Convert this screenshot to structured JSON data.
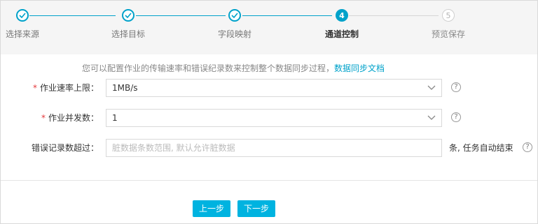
{
  "steps": [
    {
      "label": "选择来源",
      "status": "done"
    },
    {
      "label": "选择目标",
      "status": "done"
    },
    {
      "label": "字段映射",
      "status": "done"
    },
    {
      "label": "通道控制",
      "status": "active",
      "number": "4"
    },
    {
      "label": "预览保存",
      "status": "todo",
      "number": "5"
    }
  ],
  "hint": {
    "text": "您可以配置作业的传输速率和错误纪录数来控制整个数据同步过程，",
    "link": "数据同步文档"
  },
  "form": {
    "speed": {
      "label": "作业速率上限：",
      "value": "1MB/s"
    },
    "concurrency": {
      "label": "作业并发数：",
      "value": "1"
    },
    "error_limit": {
      "label": "错误记录数超过：",
      "placeholder": "脏数据条数范围, 默认允许脏数据",
      "value": "",
      "suffix": "条, 任务自动结束"
    },
    "help_icon_glyph": "?"
  },
  "buttons": {
    "prev": "上一步",
    "next": "下一步"
  },
  "colors": {
    "accent": "#00a2ca",
    "button": "#00b3e0",
    "required": "#e4393c"
  }
}
